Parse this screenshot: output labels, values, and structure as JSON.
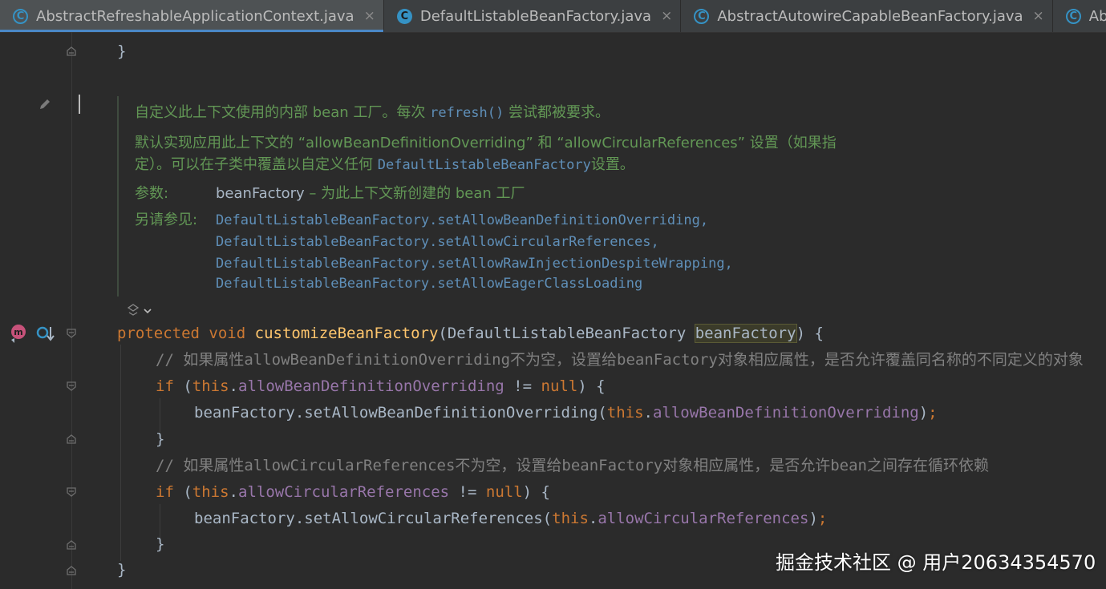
{
  "tabs": [
    {
      "label": "AbstractRefreshableApplicationContext.java",
      "icon": "abstract-class-icon",
      "active": true
    },
    {
      "label": "DefaultListableBeanFactory.java",
      "icon": "class-icon",
      "active": false
    },
    {
      "label": "AbstractAutowireCapableBeanFactory.java",
      "icon": "abstract-class-icon",
      "active": false
    },
    {
      "label": "AbstractBe",
      "icon": "abstract-class-icon",
      "active": false
    }
  ],
  "tab_close_glyph": "×",
  "code_top": {
    "close_brace": "}"
  },
  "doc": {
    "line1_a": "自定义此上下文使用的内部 bean 工厂。每次 ",
    "line1_code": "refresh()",
    "line1_b": " 尝试都被要求。",
    "line2": "默认实现应用此上下文的 “allowBeanDefinitionOverriding” 和 “allowCircularReferences” 设置（如果指",
    "line3_a": "定）。可以在子类中覆盖以自定义任何 ",
    "line3_code": "DefaultListableBeanFactory",
    "line3_b": "设置。",
    "params_label": "参数:",
    "param_name": "beanFactory",
    "param_desc": " – 为此上下文新创建的 bean 工厂",
    "see_also_label": "另请参见:",
    "see_also": [
      "DefaultListableBeanFactory.setAllowBeanDefinitionOverriding,",
      "DefaultListableBeanFactory.setAllowCircularReferences,",
      "DefaultListableBeanFactory.setAllowRawInjectionDespiteWrapping,",
      "DefaultListableBeanFactory.setAllowEagerClassLoading"
    ]
  },
  "code": {
    "sig_protected": "protected",
    "sig_void": "void",
    "sig_method": "customizeBeanFactory",
    "sig_paren_open": "(",
    "sig_type": "DefaultListableBeanFactory",
    "sig_param": "beanFactory",
    "sig_end": ") {",
    "comment1": "// 如果属性allowBeanDefinitionOverriding不为空，设置给beanFactory对象相应属性，是否允许覆盖同名称的不同定义的对象",
    "if_kw": "if",
    "this_kw": "this",
    "if1_open": " (",
    "dot": ".",
    "field1": "allowBeanDefinitionOverriding",
    "neq": " != ",
    "null_kw": "null",
    "if_close": ") {",
    "call1_a": "beanFactory.setAllowBeanDefinitionOverriding(",
    "call_close": ")",
    "semicolon": ";",
    "close_brace": "}",
    "comment2": "// 如果属性allowCircularReferences不为空，设置给beanFactory对象相应属性，是否允许bean之间存在循环依赖",
    "field2": "allowCircularReferences",
    "call2_a": "beanFactory.setAllowCircularReferences("
  },
  "watermark": "掘金技术社区 @ 用户20634354570",
  "colors": {
    "background": "#2b2b2b",
    "keyword": "#cc7832",
    "method": "#ffc66d",
    "field": "#9876aa",
    "comment": "#808080",
    "doc_text": "#629755",
    "doc_link": "#5f8fb8"
  },
  "gutter_icons": [
    "edit-pencil-icon",
    "override-method-icon",
    "implementation-icon",
    "fold-icon",
    "doc-toggle-icon"
  ]
}
